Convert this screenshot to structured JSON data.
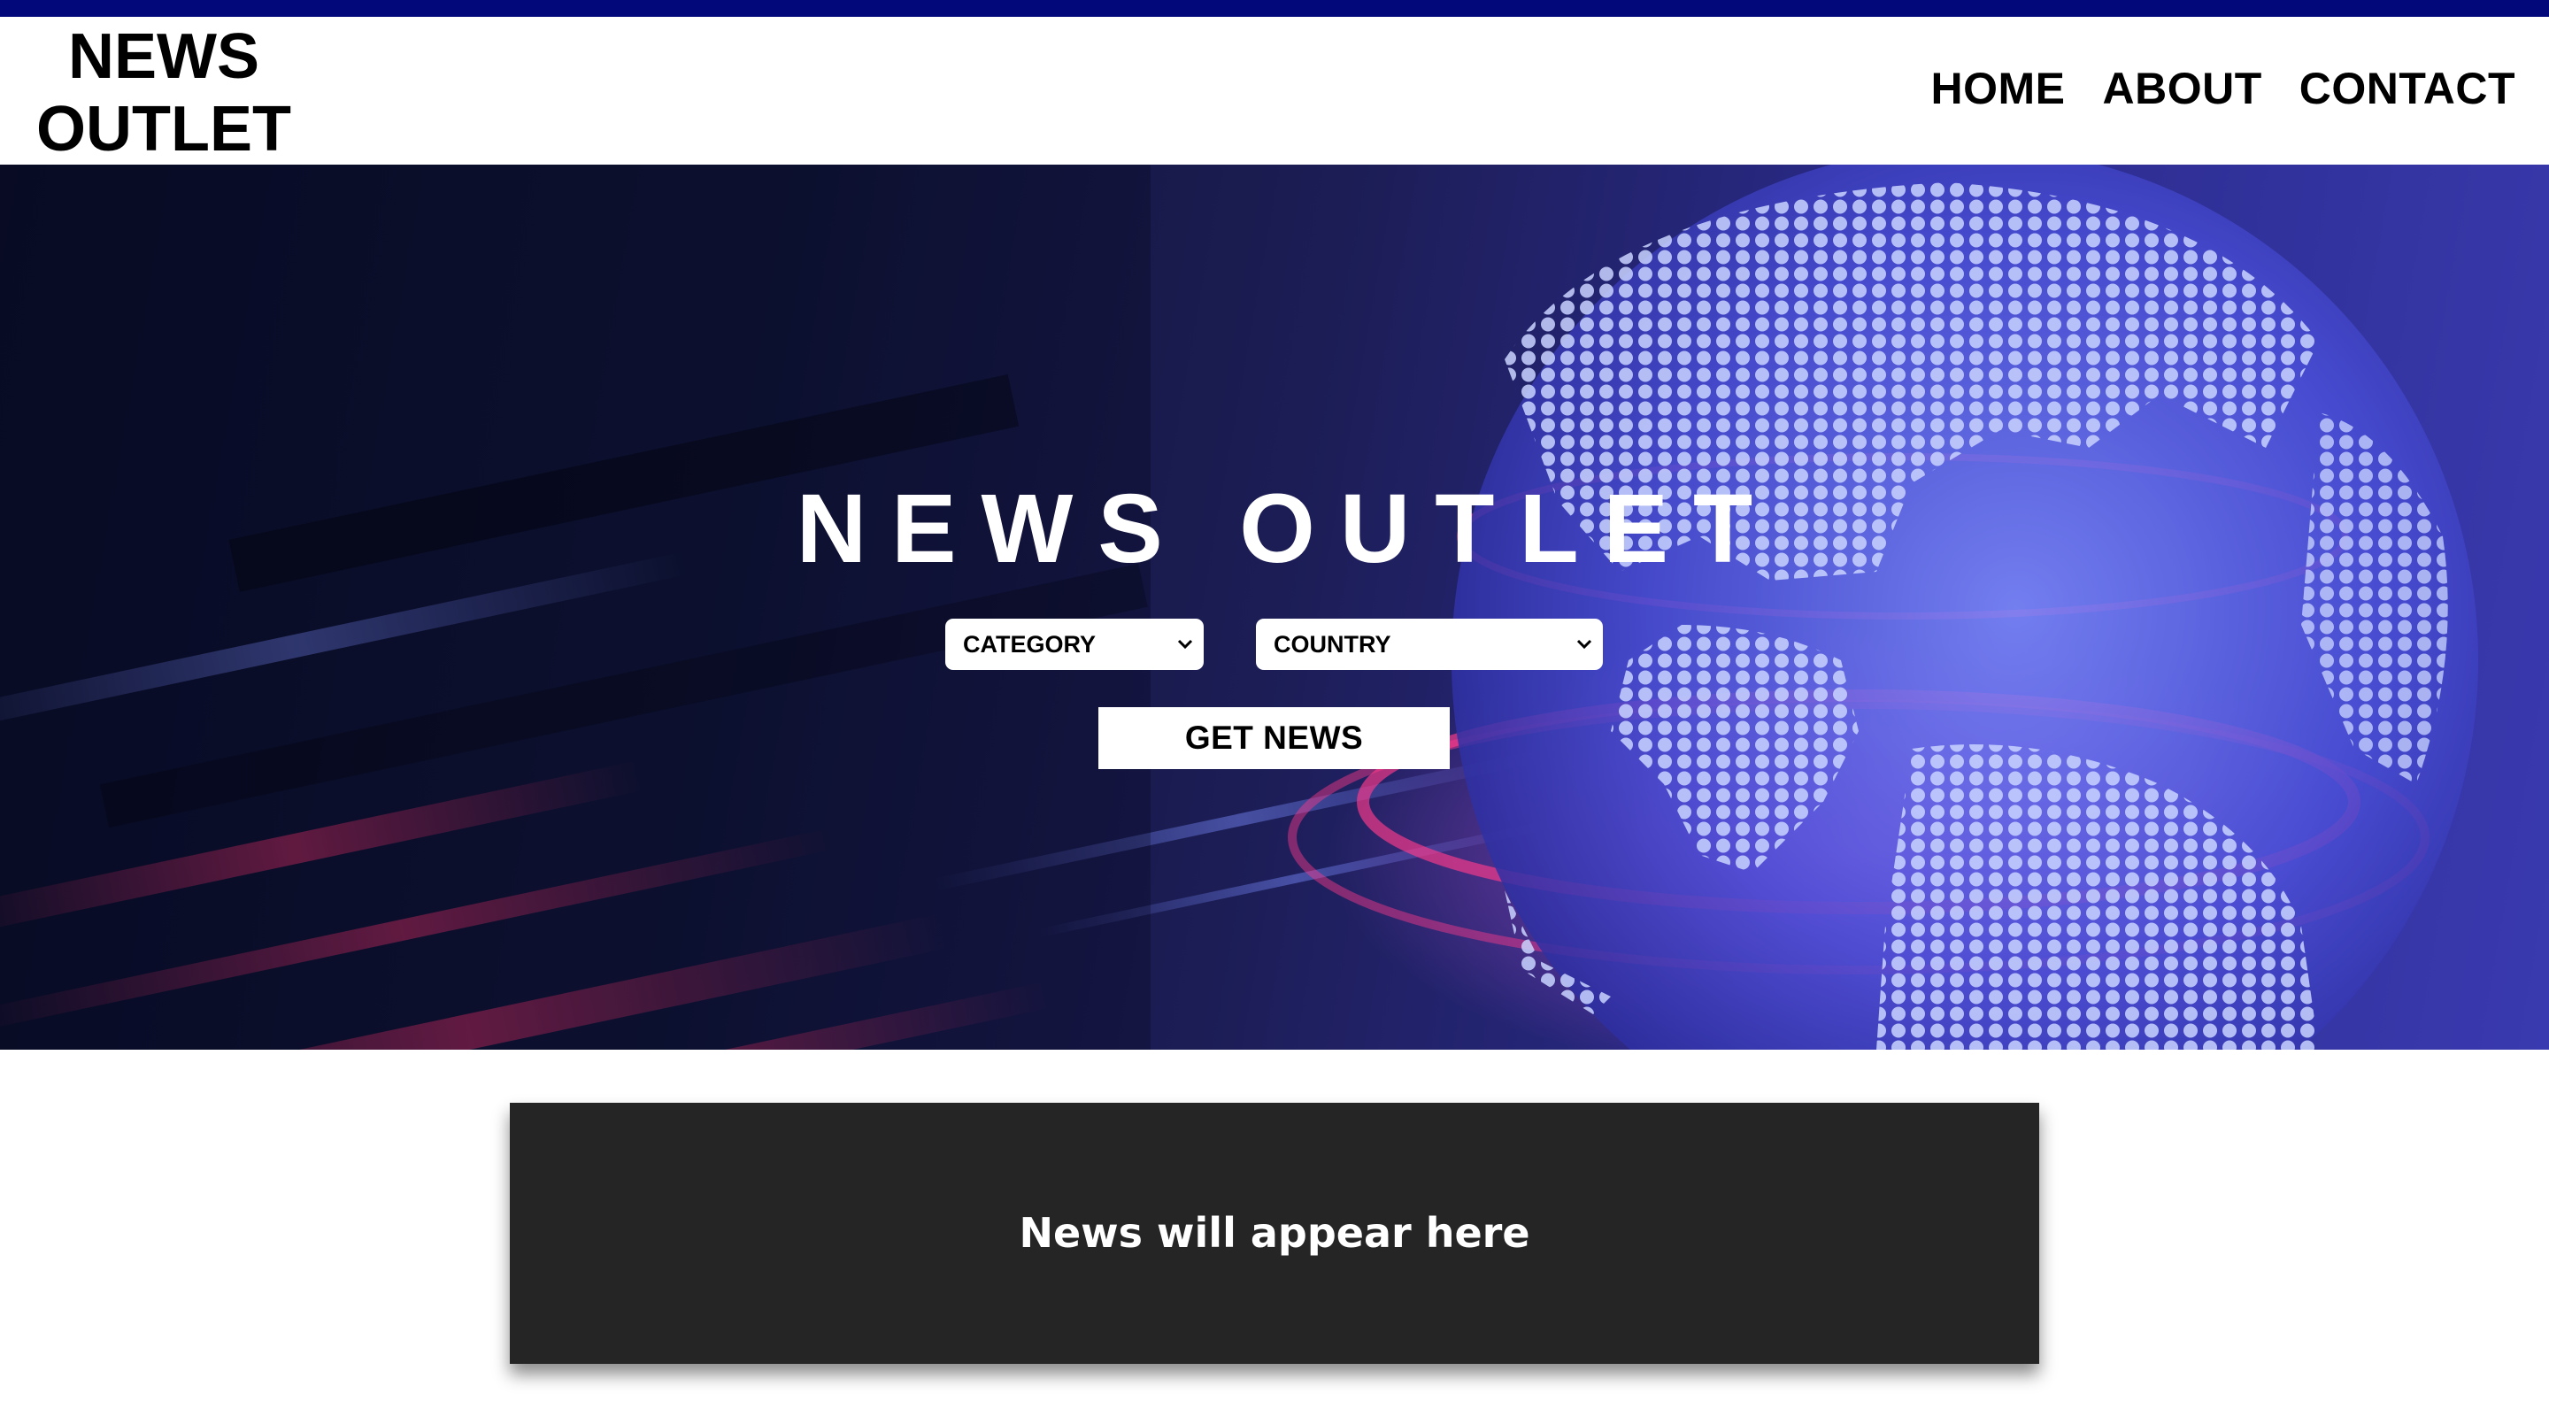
{
  "header": {
    "logo_line1": "NEWS",
    "logo_line2": "OUTLET",
    "nav": [
      {
        "label": "HOME"
      },
      {
        "label": "ABOUT"
      },
      {
        "label": "CONTACT"
      }
    ]
  },
  "hero": {
    "title": "NEWS OUTLET",
    "category_select": {
      "selected": "CATEGORY"
    },
    "country_select": {
      "selected": "COUNTRY"
    },
    "get_news_label": "GET NEWS"
  },
  "news": {
    "placeholder": "News will appear here"
  },
  "colors": {
    "top_bar": "#02087a",
    "news_box": "#252525",
    "text": "#000000"
  },
  "icons": {
    "select_arrow": "chevron-down-icon",
    "hero_image": "digital-globe-image"
  }
}
